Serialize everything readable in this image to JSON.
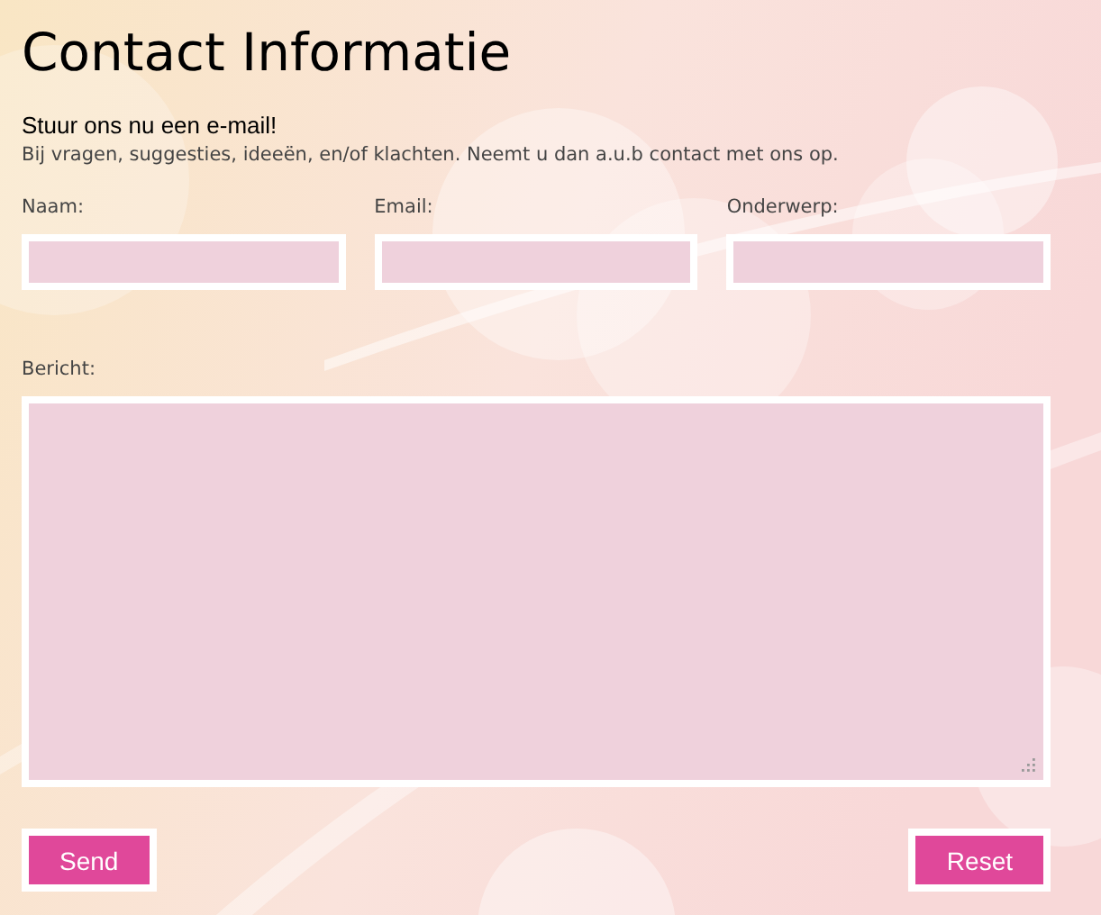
{
  "title": "Contact Informatie",
  "subtitle": "Stuur ons nu een e-mail!",
  "intro": "Bij vragen, suggesties, ideeën, en/of klachten. Neemt u dan a.u.b contact met ons op.",
  "fields": [
    {
      "label": "Naam:"
    },
    {
      "label": "Email:"
    },
    {
      "label": "Onderwerp:"
    }
  ],
  "message": {
    "label": "Bericht:"
  },
  "buttons": [
    "Send",
    "Reset"
  ]
}
